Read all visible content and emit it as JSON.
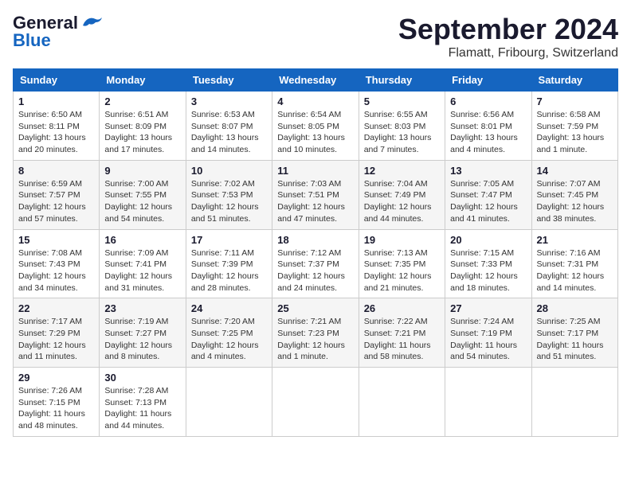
{
  "header": {
    "logo_line1": "General",
    "logo_line2": "Blue",
    "title": "September 2024",
    "subtitle": "Flamatt, Fribourg, Switzerland"
  },
  "calendar": {
    "headers": [
      "Sunday",
      "Monday",
      "Tuesday",
      "Wednesday",
      "Thursday",
      "Friday",
      "Saturday"
    ],
    "weeks": [
      [
        {
          "day": "",
          "info": ""
        },
        {
          "day": "2",
          "info": "Sunrise: 6:51 AM\nSunset: 8:09 PM\nDaylight: 13 hours and 17 minutes."
        },
        {
          "day": "3",
          "info": "Sunrise: 6:53 AM\nSunset: 8:07 PM\nDaylight: 13 hours and 14 minutes."
        },
        {
          "day": "4",
          "info": "Sunrise: 6:54 AM\nSunset: 8:05 PM\nDaylight: 13 hours and 10 minutes."
        },
        {
          "day": "5",
          "info": "Sunrise: 6:55 AM\nSunset: 8:03 PM\nDaylight: 13 hours and 7 minutes."
        },
        {
          "day": "6",
          "info": "Sunrise: 6:56 AM\nSunset: 8:01 PM\nDaylight: 13 hours and 4 minutes."
        },
        {
          "day": "7",
          "info": "Sunrise: 6:58 AM\nSunset: 7:59 PM\nDaylight: 13 hours and 1 minute."
        }
      ],
      [
        {
          "day": "8",
          "info": "Sunrise: 6:59 AM\nSunset: 7:57 PM\nDaylight: 12 hours and 57 minutes."
        },
        {
          "day": "9",
          "info": "Sunrise: 7:00 AM\nSunset: 7:55 PM\nDaylight: 12 hours and 54 minutes."
        },
        {
          "day": "10",
          "info": "Sunrise: 7:02 AM\nSunset: 7:53 PM\nDaylight: 12 hours and 51 minutes."
        },
        {
          "day": "11",
          "info": "Sunrise: 7:03 AM\nSunset: 7:51 PM\nDaylight: 12 hours and 47 minutes."
        },
        {
          "day": "12",
          "info": "Sunrise: 7:04 AM\nSunset: 7:49 PM\nDaylight: 12 hours and 44 minutes."
        },
        {
          "day": "13",
          "info": "Sunrise: 7:05 AM\nSunset: 7:47 PM\nDaylight: 12 hours and 41 minutes."
        },
        {
          "day": "14",
          "info": "Sunrise: 7:07 AM\nSunset: 7:45 PM\nDaylight: 12 hours and 38 minutes."
        }
      ],
      [
        {
          "day": "15",
          "info": "Sunrise: 7:08 AM\nSunset: 7:43 PM\nDaylight: 12 hours and 34 minutes."
        },
        {
          "day": "16",
          "info": "Sunrise: 7:09 AM\nSunset: 7:41 PM\nDaylight: 12 hours and 31 minutes."
        },
        {
          "day": "17",
          "info": "Sunrise: 7:11 AM\nSunset: 7:39 PM\nDaylight: 12 hours and 28 minutes."
        },
        {
          "day": "18",
          "info": "Sunrise: 7:12 AM\nSunset: 7:37 PM\nDaylight: 12 hours and 24 minutes."
        },
        {
          "day": "19",
          "info": "Sunrise: 7:13 AM\nSunset: 7:35 PM\nDaylight: 12 hours and 21 minutes."
        },
        {
          "day": "20",
          "info": "Sunrise: 7:15 AM\nSunset: 7:33 PM\nDaylight: 12 hours and 18 minutes."
        },
        {
          "day": "21",
          "info": "Sunrise: 7:16 AM\nSunset: 7:31 PM\nDaylight: 12 hours and 14 minutes."
        }
      ],
      [
        {
          "day": "22",
          "info": "Sunrise: 7:17 AM\nSunset: 7:29 PM\nDaylight: 12 hours and 11 minutes."
        },
        {
          "day": "23",
          "info": "Sunrise: 7:19 AM\nSunset: 7:27 PM\nDaylight: 12 hours and 8 minutes."
        },
        {
          "day": "24",
          "info": "Sunrise: 7:20 AM\nSunset: 7:25 PM\nDaylight: 12 hours and 4 minutes."
        },
        {
          "day": "25",
          "info": "Sunrise: 7:21 AM\nSunset: 7:23 PM\nDaylight: 12 hours and 1 minute."
        },
        {
          "day": "26",
          "info": "Sunrise: 7:22 AM\nSunset: 7:21 PM\nDaylight: 11 hours and 58 minutes."
        },
        {
          "day": "27",
          "info": "Sunrise: 7:24 AM\nSunset: 7:19 PM\nDaylight: 11 hours and 54 minutes."
        },
        {
          "day": "28",
          "info": "Sunrise: 7:25 AM\nSunset: 7:17 PM\nDaylight: 11 hours and 51 minutes."
        }
      ],
      [
        {
          "day": "29",
          "info": "Sunrise: 7:26 AM\nSunset: 7:15 PM\nDaylight: 11 hours and 48 minutes."
        },
        {
          "day": "30",
          "info": "Sunrise: 7:28 AM\nSunset: 7:13 PM\nDaylight: 11 hours and 44 minutes."
        },
        {
          "day": "",
          "info": ""
        },
        {
          "day": "",
          "info": ""
        },
        {
          "day": "",
          "info": ""
        },
        {
          "day": "",
          "info": ""
        },
        {
          "day": "",
          "info": ""
        }
      ]
    ],
    "week0": [
      {
        "day": "1",
        "info": "Sunrise: 6:50 AM\nSunset: 8:11 PM\nDaylight: 13 hours and 20 minutes."
      },
      {
        "day": "2",
        "info": "Sunrise: 6:51 AM\nSunset: 8:09 PM\nDaylight: 13 hours and 17 minutes."
      },
      {
        "day": "3",
        "info": "Sunrise: 6:53 AM\nSunset: 8:07 PM\nDaylight: 13 hours and 14 minutes."
      },
      {
        "day": "4",
        "info": "Sunrise: 6:54 AM\nSunset: 8:05 PM\nDaylight: 13 hours and 10 minutes."
      },
      {
        "day": "5",
        "info": "Sunrise: 6:55 AM\nSunset: 8:03 PM\nDaylight: 13 hours and 7 minutes."
      },
      {
        "day": "6",
        "info": "Sunrise: 6:56 AM\nSunset: 8:01 PM\nDaylight: 13 hours and 4 minutes."
      },
      {
        "day": "7",
        "info": "Sunrise: 6:58 AM\nSunset: 7:59 PM\nDaylight: 13 hours and 1 minute."
      }
    ]
  }
}
